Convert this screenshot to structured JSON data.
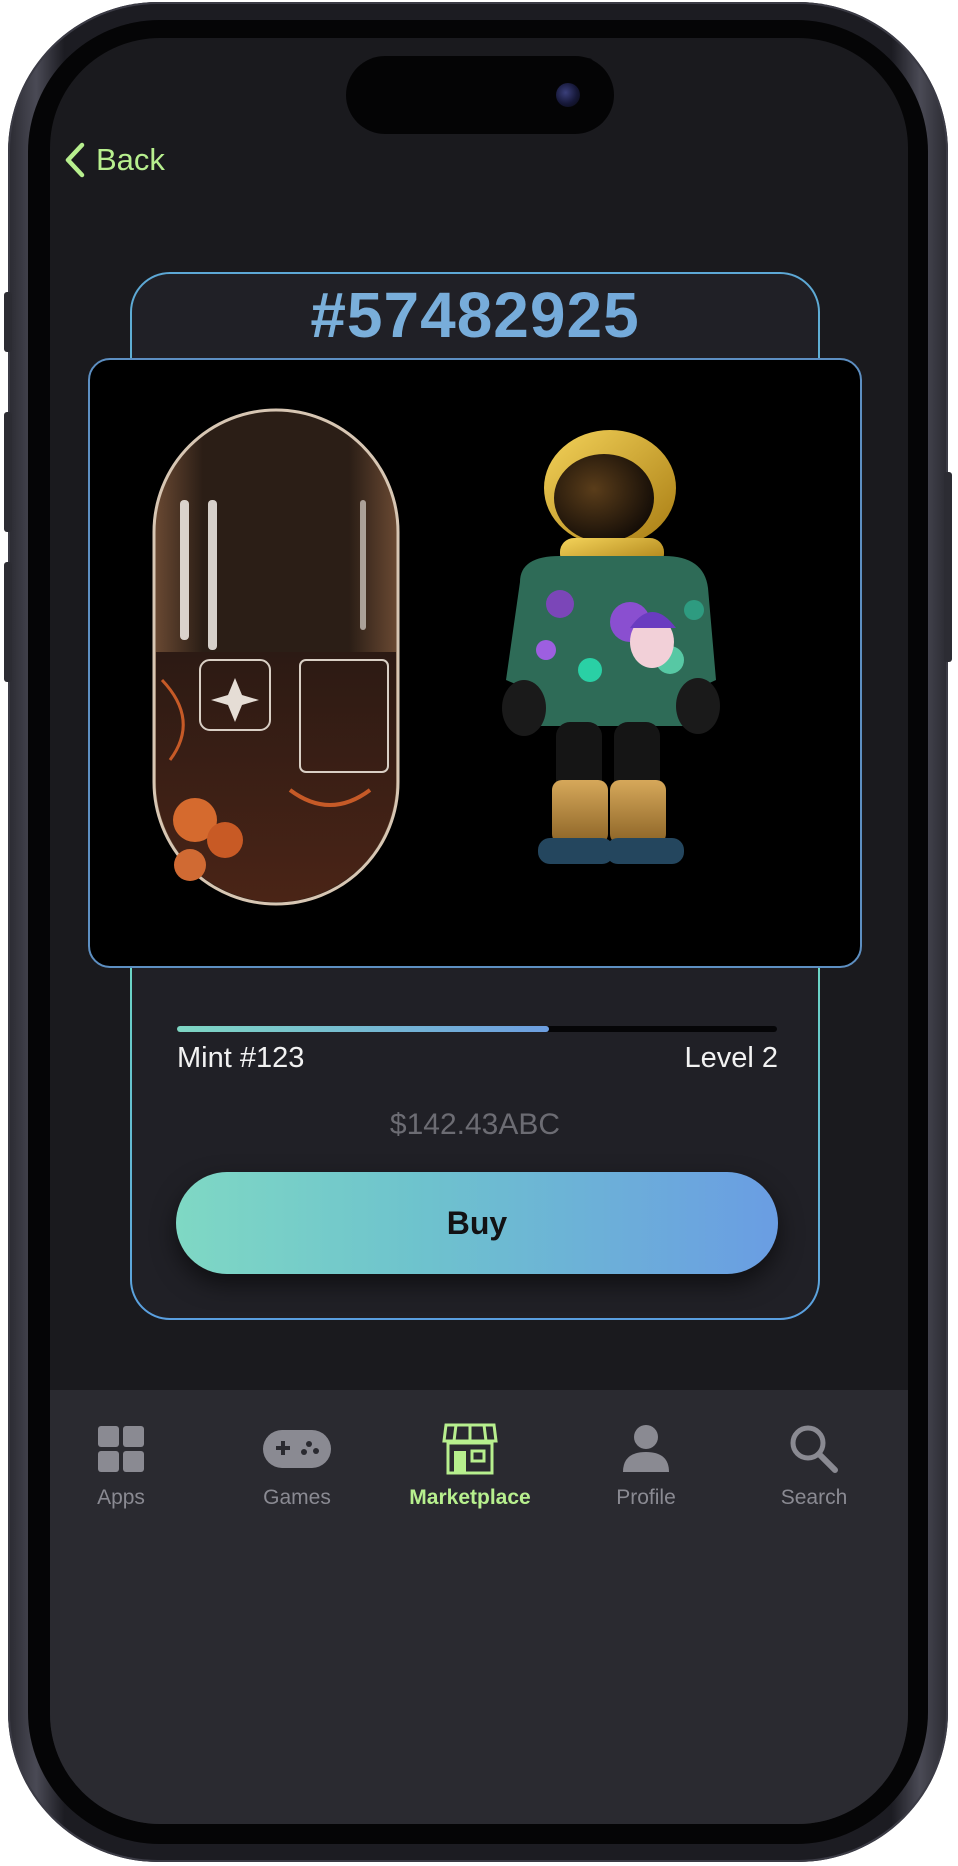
{
  "nav": {
    "back_label": "Back"
  },
  "item": {
    "id": "#57482925",
    "mint": "Mint #123",
    "level": "Level 2",
    "price": "$142.43ABC",
    "buy_label": "Buy",
    "progress_fraction": 0.62
  },
  "tabs": [
    {
      "label": "Apps",
      "icon": "apps-grid-icon",
      "active": false
    },
    {
      "label": "Games",
      "icon": "gamepad-icon",
      "active": false
    },
    {
      "label": "Marketplace",
      "icon": "storefront-icon",
      "active": true
    },
    {
      "label": "Profile",
      "icon": "person-icon",
      "active": false
    },
    {
      "label": "Search",
      "icon": "search-icon",
      "active": false
    }
  ],
  "colors": {
    "accent_green": "#b7ef8e",
    "gradient_start": "#7fd8c4",
    "gradient_end": "#6a9de3",
    "card_bg": "#202026",
    "screen_bg": "#1a1a1e"
  }
}
